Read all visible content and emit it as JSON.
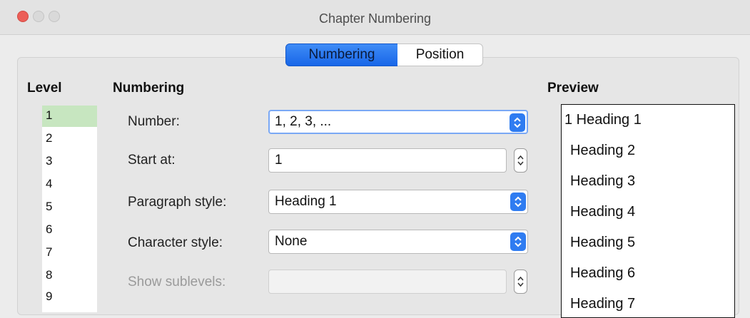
{
  "window": {
    "title": "Chapter Numbering"
  },
  "tabs": [
    {
      "label": "Numbering",
      "selected": true
    },
    {
      "label": "Position",
      "selected": false
    }
  ],
  "level": {
    "heading": "Level",
    "items": [
      "1",
      "2",
      "3",
      "4",
      "5",
      "6",
      "7",
      "8",
      "9"
    ],
    "selected": "1"
  },
  "numbering": {
    "heading": "Numbering",
    "number": {
      "label": "Number:",
      "value": "1, 2, 3, ..."
    },
    "start_at": {
      "label": "Start at:",
      "value": "1"
    },
    "paragraph_style": {
      "label": "Paragraph style:",
      "value": "Heading 1"
    },
    "character_style": {
      "label": "Character style:",
      "value": "None"
    },
    "show_sublevels": {
      "label": "Show sublevels:",
      "value": ""
    }
  },
  "preview": {
    "heading": "Preview",
    "items": [
      "1 Heading 1",
      "Heading 2",
      "Heading 3",
      "Heading 4",
      "Heading 5",
      "Heading 6",
      "Heading 7"
    ]
  },
  "colors": {
    "accent": "#1f6ff0",
    "selection": "#c7e6c0",
    "close": "#ec5f58"
  }
}
